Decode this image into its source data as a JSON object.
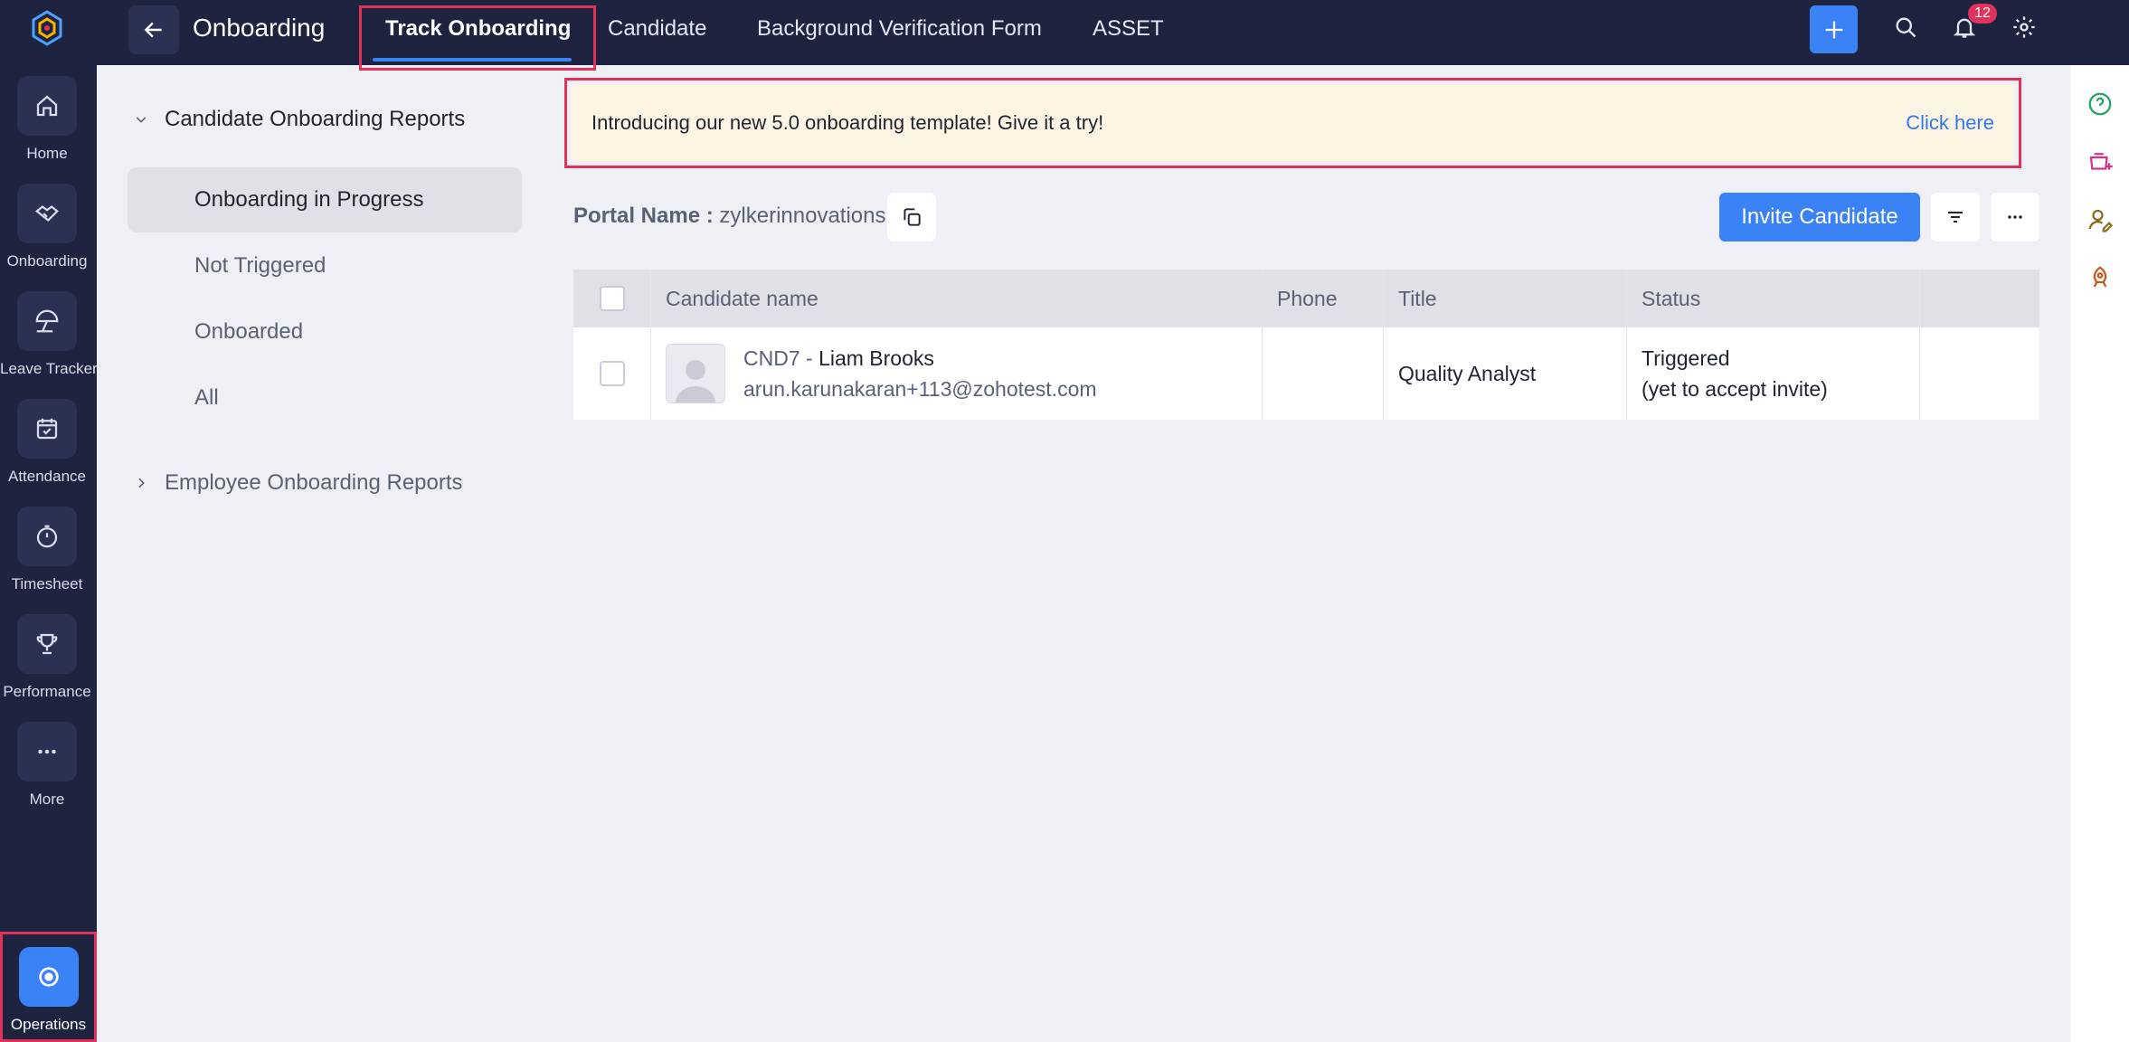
{
  "rail": {
    "items": [
      {
        "label": "Home",
        "icon": "home-icon"
      },
      {
        "label": "Onboarding",
        "icon": "handshake-icon"
      },
      {
        "label": "Leave Tracker",
        "icon": "beach-umbrella-icon"
      },
      {
        "label": "Attendance",
        "icon": "calendar-check-icon"
      },
      {
        "label": "Timesheet",
        "icon": "stopwatch-icon"
      },
      {
        "label": "Performance",
        "icon": "trophy-icon"
      },
      {
        "label": "More",
        "icon": "more-dots-icon"
      }
    ],
    "operations_label": "Operations"
  },
  "header": {
    "title": "Onboarding",
    "tabs": [
      {
        "label": "Track Onboarding"
      },
      {
        "label": "Candidate"
      },
      {
        "label": "Background Verification Form"
      },
      {
        "label": "ASSET"
      }
    ],
    "notification_count": "12"
  },
  "sidebar": {
    "candidate_reports_label": "Candidate Onboarding Reports",
    "items": [
      {
        "label": "Onboarding in Progress"
      },
      {
        "label": "Not Triggered"
      },
      {
        "label": "Onboarded"
      },
      {
        "label": "All"
      }
    ],
    "employee_reports_label": "Employee Onboarding Reports"
  },
  "banner": {
    "text": "Introducing our new 5.0 onboarding template! Give it a try!",
    "link": "Click here"
  },
  "portal": {
    "label": "Portal Name :",
    "name": "zylkerinnovations"
  },
  "actions": {
    "invite_label": "Invite Candidate"
  },
  "table": {
    "columns": [
      "Candidate name",
      "Phone",
      "Title",
      "Status"
    ],
    "rows": [
      {
        "id": "CND7 -",
        "name": "Liam Brooks",
        "email": "arun.karunakaran+113@zohotest.com",
        "phone": "",
        "title": "Quality Analyst",
        "status_line1": "Triggered",
        "status_line2": "(yet to accept invite)"
      }
    ]
  },
  "colors": {
    "rail_bg": "#1e2340",
    "accent": "#3b82f6",
    "highlight": "#e0325a",
    "banner_bg": "#fdf4e4"
  }
}
